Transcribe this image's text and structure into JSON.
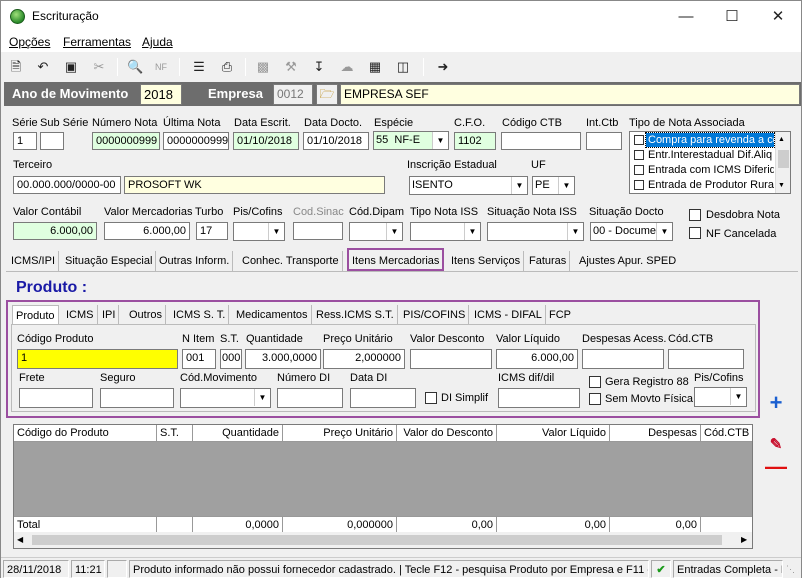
{
  "window": {
    "title": "Escrituração"
  },
  "menu": {
    "items": [
      "Opções",
      "Ferramentas",
      "Ajuda"
    ]
  },
  "header": {
    "ano_label": "Ano de Movimento",
    "ano_value": "2018",
    "empresa_label": "Empresa",
    "empresa_code": "0012",
    "empresa_name": "EMPRESA SEF"
  },
  "doc": {
    "serie_label": "Série",
    "serie_value": "1",
    "subserie_label": "Sub Série",
    "subserie_value": "",
    "numero_label": "Número Nota",
    "numero_value": "0000000999",
    "ultima_label": "Última Nota",
    "ultima_value": "0000000999",
    "data_escrit_label": "Data Escrit.",
    "data_escrit_value": "01/10/2018",
    "data_docto_label": "Data Docto.",
    "data_docto_value": "01/10/2018",
    "especie_label": "Espécie",
    "especie_code": "55",
    "especie_value": "NF-E",
    "cfo_label": "C.F.O.",
    "cfo_value": "1102",
    "codigo_ctb_label": "Código CTB",
    "codigo_ctb_value": "",
    "int_ctb_label": "Int.Ctb",
    "int_ctb_value": "",
    "tipo_nota_label": "Tipo de Nota Associada",
    "tipo_nota_items": [
      "Compra para revenda a co",
      "Entr.Interestadual Dif.Aliq",
      "Entrada com ICMS Diferido",
      "Entrada de Produtor Rural"
    ],
    "terceiro_label": "Terceiro",
    "terceiro_code": "00.000.000/0000-00",
    "terceiro_name": "PROSOFT WK",
    "ie_label": "Inscrição Estadual",
    "ie_value": "ISENTO",
    "uf_label": "UF",
    "uf_value": "PE",
    "valor_contabil_label": "Valor Contábil",
    "valor_contabil_value": "6.000,00",
    "valor_merc_label": "Valor Mercadorias",
    "valor_merc_value": "6.000,00",
    "turbo_label": "Turbo",
    "turbo_value": "17",
    "pis_label": "Pis/Cofins",
    "codsinac_label": "Cod.Sinac",
    "coddipam_label": "Cód.Dipam",
    "tipo_iss_label": "Tipo Nota ISS",
    "sit_iss_label": "Situação Nota ISS",
    "sit_docto_label": "Situação Docto",
    "sit_docto_value": "00 - Documen",
    "desdobra_label": "Desdobra Nota",
    "nfcancel_label": "NF Cancelada"
  },
  "tabs": [
    "ICMS/IPI",
    "Situação Especial",
    "Outras Inform.",
    "Conhec. Transporte",
    "Itens Mercadorias",
    "Itens Serviços",
    "Faturas",
    "Ajustes Apur. SPED"
  ],
  "produto": {
    "title": "Produto :",
    "subtabs": [
      "Produto",
      "ICMS",
      "IPI",
      "Outros",
      "ICMS S. T.",
      "Medicamentos",
      "Ress.ICMS S.T.",
      "PIS/COFINS",
      "ICMS - DIFAL",
      "FCP"
    ],
    "codigo_label": "Código Produto",
    "codigo_value": "1",
    "nitem_label": "N Item",
    "nitem_value": "001",
    "st_label": "S.T.",
    "st_value": "000",
    "qtd_label": "Quantidade",
    "qtd_value": "3.000,0000",
    "preco_label": "Preço Unitário",
    "preco_value": "2,000000",
    "desconto_label": "Valor Desconto",
    "liquido_label": "Valor Líquido",
    "liquido_value": "6.000,00",
    "despesas_label": "Despesas Acess.",
    "codctb_label": "Cód.CTB",
    "frete_label": "Frete",
    "seguro_label": "Seguro",
    "codmov_label": "Cód.Movimento",
    "numdi_label": "Número DI",
    "datadi_label": "Data DI",
    "disimpl_label": "DI Simplif",
    "icmsdif_label": "ICMS dif/dil",
    "gera_label": "Gera Registro 88",
    "semmovto_label": "Sem Movto Física",
    "piscofins_label": "Pis/Cofins"
  },
  "grid": {
    "columns": [
      "Código do Produto",
      "S.T.",
      "Quantidade",
      "Preço Unitário",
      "Valor do Desconto",
      "Valor Líquido",
      "Despesas",
      "Cód.CTB"
    ],
    "total_label": "Total",
    "totals": [
      "0,0000",
      "0,000000",
      "0,00",
      "0,00",
      "0,00"
    ]
  },
  "status": {
    "date": "28/11/2018",
    "time": "11:21",
    "message": "Produto informado não possui fornecedor cadastrado. | Tecle F12 - pesquisa Produto por Empresa e F11 - p",
    "mode": "Entradas Completa - P"
  },
  "colors": {
    "purple_highlight": "#9b4fa0",
    "yellow": "#ffff00",
    "green": "#e0ffe0",
    "blue_title": "#1a1aa6"
  }
}
